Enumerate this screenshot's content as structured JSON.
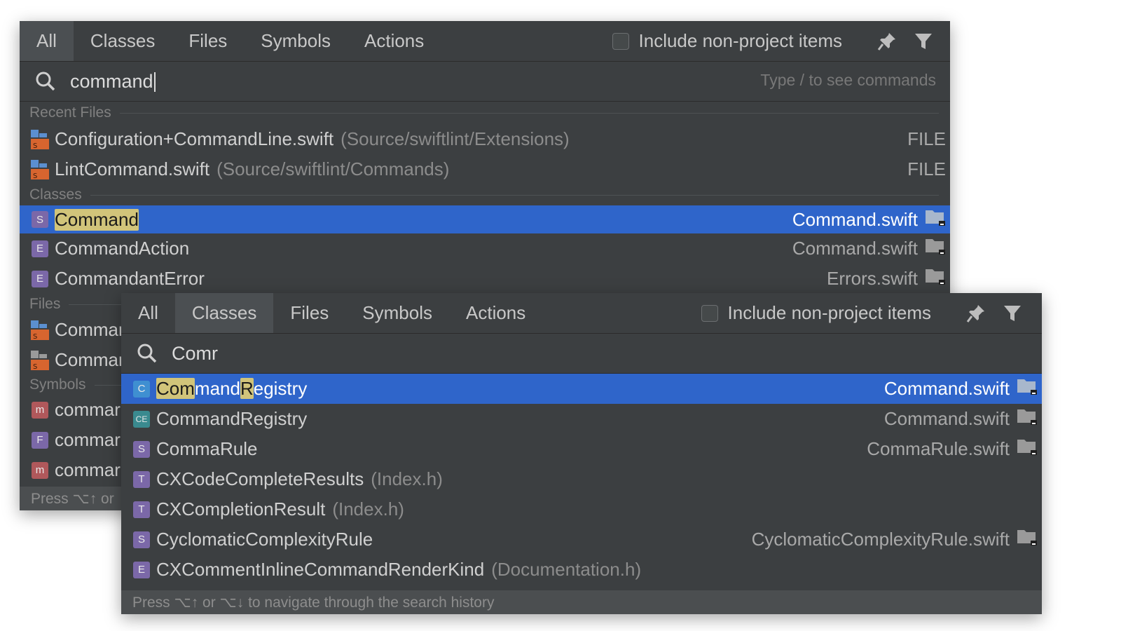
{
  "colors": {
    "popup_bg": "#3c3f41",
    "selection": "#2f65ca",
    "highlight": "#d1c47a"
  },
  "back_popup": {
    "tabs": [
      "All",
      "Classes",
      "Files",
      "Symbols",
      "Actions"
    ],
    "active_tab": "All",
    "include_label": "Include non-project items",
    "search_value": "command",
    "search_hint": "Type / to see commands",
    "sections": {
      "recent_files": "Recent Files",
      "classes": "Classes",
      "files": "Files",
      "symbols": "Symbols"
    },
    "recent_files": [
      {
        "name": "Configuration+CommandLine.swift",
        "path": "(Source/swiftlint/Extensions)",
        "kind": "FILE"
      },
      {
        "name": "LintCommand.swift",
        "path": "(Source/swiftlint/Commands)",
        "kind": "FILE"
      }
    ],
    "classes": [
      {
        "badge": "S",
        "name": "Command",
        "file": "Command.swift"
      },
      {
        "badge": "E",
        "name": "CommandAction",
        "file": "Command.swift"
      },
      {
        "badge": "E",
        "name": "CommandantError",
        "file": "Errors.swift"
      }
    ],
    "files_partial": [
      "Commar",
      "Commar"
    ],
    "symbols_partial": [
      {
        "badge": "m",
        "name": "commar"
      },
      {
        "badge": "F",
        "name": "commar"
      },
      {
        "badge": "m",
        "name": "commar"
      }
    ],
    "footer": "Press ⌥↑ or"
  },
  "front_popup": {
    "tabs": [
      "All",
      "Classes",
      "Files",
      "Symbols",
      "Actions"
    ],
    "active_tab": "Classes",
    "include_label": "Include non-project items",
    "search_value": "Comr",
    "results": [
      {
        "badge": "C",
        "name_parts": [
          "Com",
          "mand",
          "R",
          "egistry"
        ],
        "file": "Command.swift"
      },
      {
        "badge": "CE",
        "name": "CommandRegistry",
        "file": "Command.swift"
      },
      {
        "badge": "S",
        "name": "CommaRule",
        "file": "CommaRule.swift"
      },
      {
        "badge": "T",
        "name": "CXCodeCompleteResults",
        "path": "(Index.h)"
      },
      {
        "badge": "T",
        "name": "CXCompletionResult",
        "path": "(Index.h)"
      },
      {
        "badge": "S",
        "name": "CyclomaticComplexityRule",
        "file": "CyclomaticComplexityRule.swift"
      },
      {
        "badge": "E",
        "name": "CXCommentInlineCommandRenderKind",
        "path": "(Documentation.h)"
      }
    ],
    "footer": "Press ⌥↑ or ⌥↓ to navigate through the search history"
  }
}
